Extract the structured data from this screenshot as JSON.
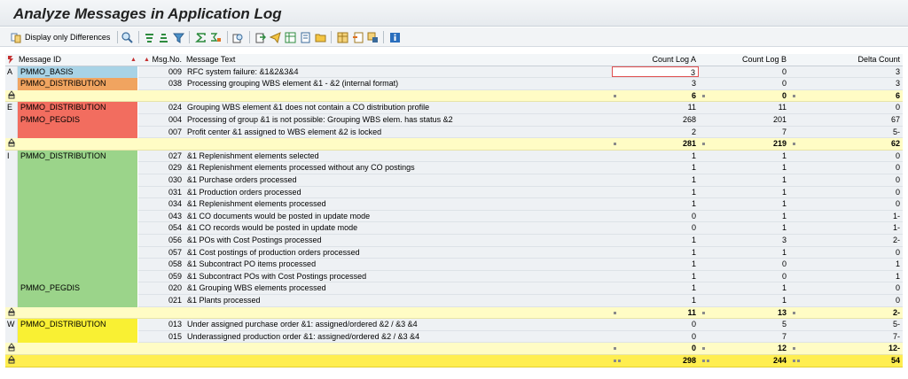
{
  "title": "Analyze Messages in Application Log",
  "toolbar": {
    "display_label": "Display only Differences"
  },
  "columns": {
    "type": "",
    "msg_id": "Message ID",
    "msg_no": "Msg.No.",
    "text": "Message Text",
    "log_a": "Count Log A",
    "log_b": "Count Log B",
    "delta": "Delta Count"
  },
  "colors": {
    "abort": "#a8d3e6",
    "abort_alt": "#f0a460",
    "error": "#f26d5f",
    "info": "#9bd48a",
    "warning": "#f9f033",
    "subtotal": "#fffcc5",
    "total": "#ffee50"
  },
  "groups": [
    {
      "type": "A",
      "blocks": [
        {
          "id": "PMMO_BASIS",
          "rows": [
            {
              "no": "009",
              "text": "RFC system failure: &1&2&3&4",
              "a": "3",
              "b": "0",
              "d": "3"
            }
          ]
        },
        {
          "id": "PMMO_DISTRIBUTION",
          "rows": [
            {
              "no": "038",
              "text": "Processing grouping WBS element &1  - &2 (internal format)",
              "a": "3",
              "b": "0",
              "d": "3"
            }
          ]
        }
      ],
      "subtotal": {
        "a": "6",
        "b": "0",
        "d": "6"
      }
    },
    {
      "type": "E",
      "blocks": [
        {
          "id": "PMMO_DISTRIBUTION",
          "rows": [
            {
              "no": "024",
              "text": "Grouping WBS element &1 does not contain a CO distribution profile",
              "a": "11",
              "b": "11",
              "d": "0"
            }
          ]
        },
        {
          "id": "PMMO_PEGDIS",
          "rows": [
            {
              "no": "004",
              "text": "Processing of group &1 is not possible: Grouping WBS elem. has status &2",
              "a": "268",
              "b": "201",
              "d": "67"
            },
            {
              "no": "007",
              "text": "Profit center &1 assigned to WBS element &2 is locked",
              "a": "2",
              "b": "7",
              "d": "5-"
            }
          ]
        }
      ],
      "subtotal": {
        "a": "281",
        "b": "219",
        "d": "62"
      }
    },
    {
      "type": "I",
      "blocks": [
        {
          "id": "PMMO_DISTRIBUTION",
          "rows": [
            {
              "no": "027",
              "text": "&1 Replenishment elements selected",
              "a": "1",
              "b": "1",
              "d": "0"
            },
            {
              "no": "029",
              "text": "&1 Replenishment elements processed without any CO postings",
              "a": "1",
              "b": "1",
              "d": "0"
            },
            {
              "no": "030",
              "text": "&1 Purchase orders processed",
              "a": "1",
              "b": "1",
              "d": "0"
            },
            {
              "no": "031",
              "text": "&1 Production orders processed",
              "a": "1",
              "b": "1",
              "d": "0"
            },
            {
              "no": "034",
              "text": "&1 Replenishment elements processed",
              "a": "1",
              "b": "1",
              "d": "0"
            },
            {
              "no": "043",
              "text": "&1 CO documents would be posted in update mode",
              "a": "0",
              "b": "1",
              "d": "1-"
            },
            {
              "no": "054",
              "text": "&1 CO records would be posted in update mode",
              "a": "0",
              "b": "1",
              "d": "1-"
            },
            {
              "no": "056",
              "text": "&1 POs with Cost Postings processed",
              "a": "1",
              "b": "3",
              "d": "2-"
            },
            {
              "no": "057",
              "text": "&1 Cost postings of production orders processed",
              "a": "1",
              "b": "1",
              "d": "0"
            },
            {
              "no": "058",
              "text": "&1 Subcontract PO items processed",
              "a": "1",
              "b": "0",
              "d": "1"
            },
            {
              "no": "059",
              "text": "&1 Subcontract POs with Cost Postings processed",
              "a": "1",
              "b": "0",
              "d": "1"
            }
          ]
        },
        {
          "id": "PMMO_PEGDIS",
          "rows": [
            {
              "no": "020",
              "text": "&1 Grouping WBS elements processed",
              "a": "1",
              "b": "1",
              "d": "0"
            },
            {
              "no": "021",
              "text": "&1 Plants processed",
              "a": "1",
              "b": "1",
              "d": "0"
            }
          ]
        }
      ],
      "subtotal": {
        "a": "11",
        "b": "13",
        "d": "2-"
      }
    },
    {
      "type": "W",
      "blocks": [
        {
          "id": "PMMO_DISTRIBUTION",
          "rows": [
            {
              "no": "013",
              "text": "Under assigned purchase order &1: assigned/ordered &2 / &3 &4",
              "a": "0",
              "b": "5",
              "d": "5-"
            },
            {
              "no": "015",
              "text": "Underassigned production order &1: assigned/ordered &2 / &3 &4",
              "a": "0",
              "b": "7",
              "d": "7-"
            }
          ]
        }
      ],
      "subtotal": {
        "a": "0",
        "b": "12",
        "d": "12-"
      }
    }
  ],
  "total": {
    "a": "298",
    "b": "244",
    "d": "54"
  }
}
